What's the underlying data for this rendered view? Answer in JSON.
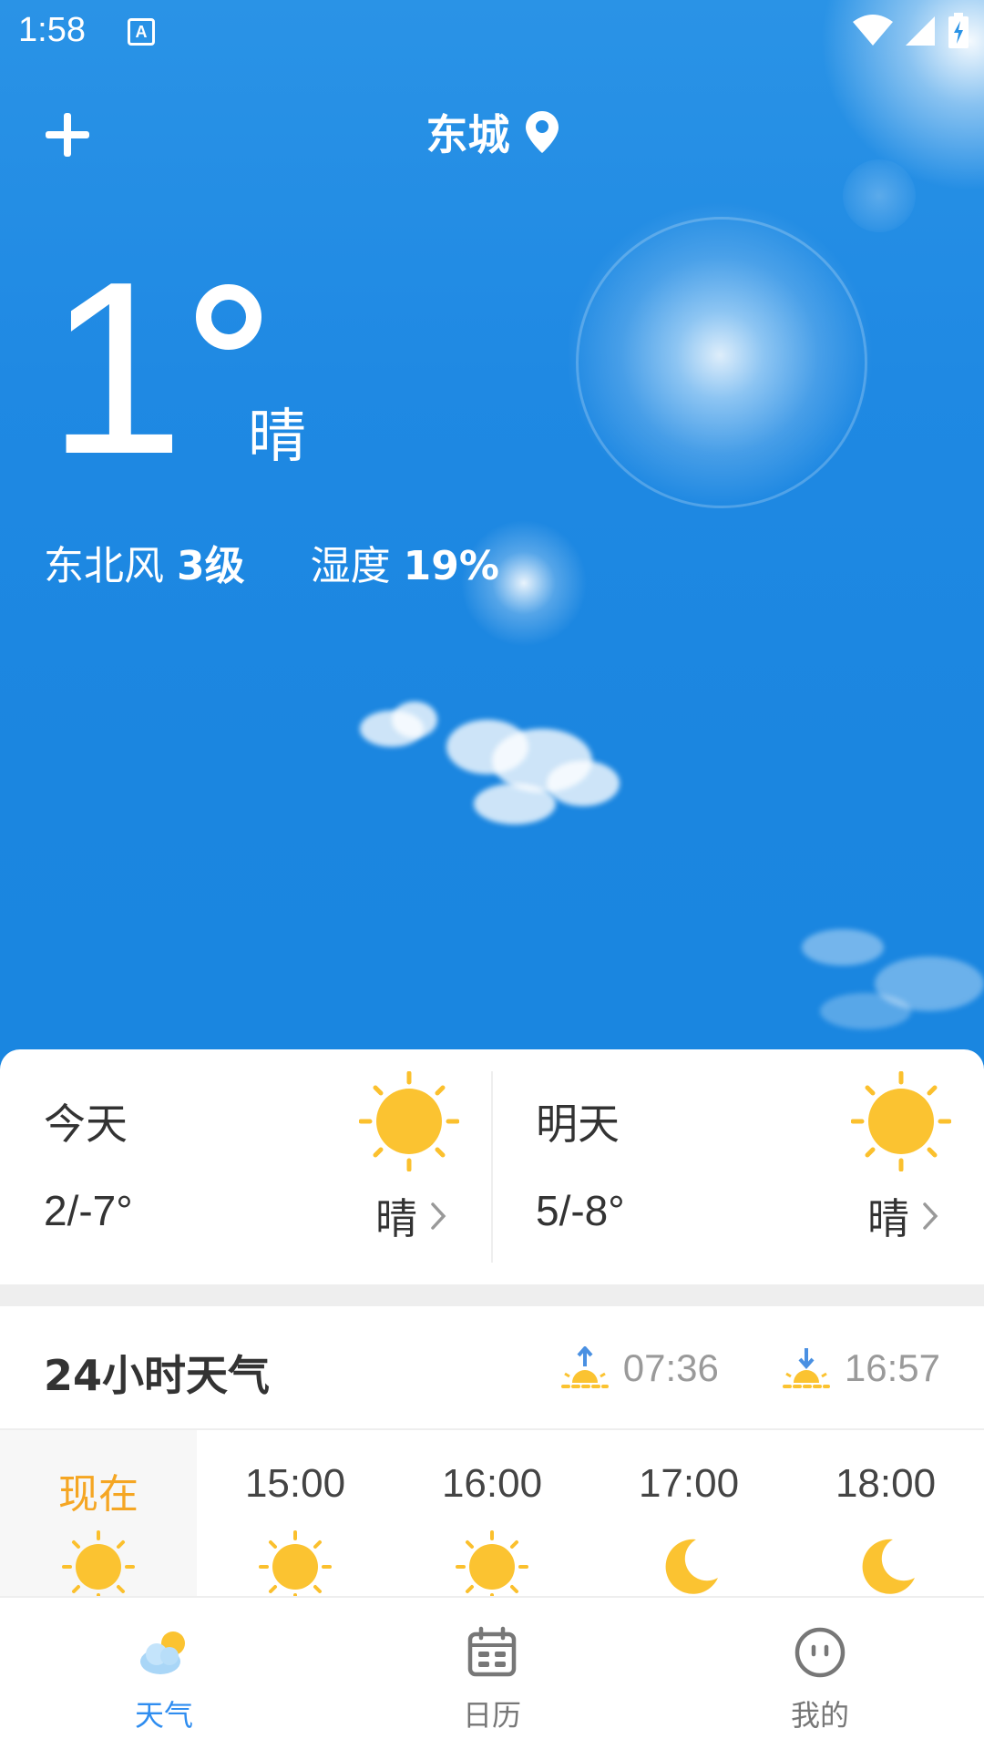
{
  "status_bar": {
    "time": "1:58",
    "app_icon_letter": "A"
  },
  "header": {
    "city": "东城",
    "add_icon": "plus-icon",
    "location_icon": "location-pin-icon"
  },
  "current": {
    "temperature": "1",
    "condition": "晴",
    "wind_label": "东北风",
    "wind_level": "3级",
    "humidity_label": "湿度",
    "humidity_value": "19%"
  },
  "forecast": [
    {
      "day": "今天",
      "range": "2/-7°",
      "condition": "晴",
      "icon": "sun-icon"
    },
    {
      "day": "明天",
      "range": "5/-8°",
      "condition": "晴",
      "icon": "sun-icon"
    }
  ],
  "hourly": {
    "title": "24小时天气",
    "sunrise": "07:36",
    "sunset": "16:57",
    "items": [
      {
        "time": "现在",
        "icon": "sun-icon"
      },
      {
        "time": "15:00",
        "icon": "sun-icon"
      },
      {
        "time": "16:00",
        "icon": "sun-icon"
      },
      {
        "time": "17:00",
        "icon": "moon-icon"
      },
      {
        "time": "18:00",
        "icon": "moon-icon"
      }
    ]
  },
  "nav": [
    {
      "label": "天气",
      "icon": "weather-icon",
      "active": true
    },
    {
      "label": "日历",
      "icon": "calendar-icon",
      "active": false
    },
    {
      "label": "我的",
      "icon": "profile-icon",
      "active": false
    }
  ],
  "colors": {
    "sky": "#1f89e3",
    "accent": "#f5a623",
    "nav_active": "#2f8df0",
    "sun": "#fbc02d"
  }
}
